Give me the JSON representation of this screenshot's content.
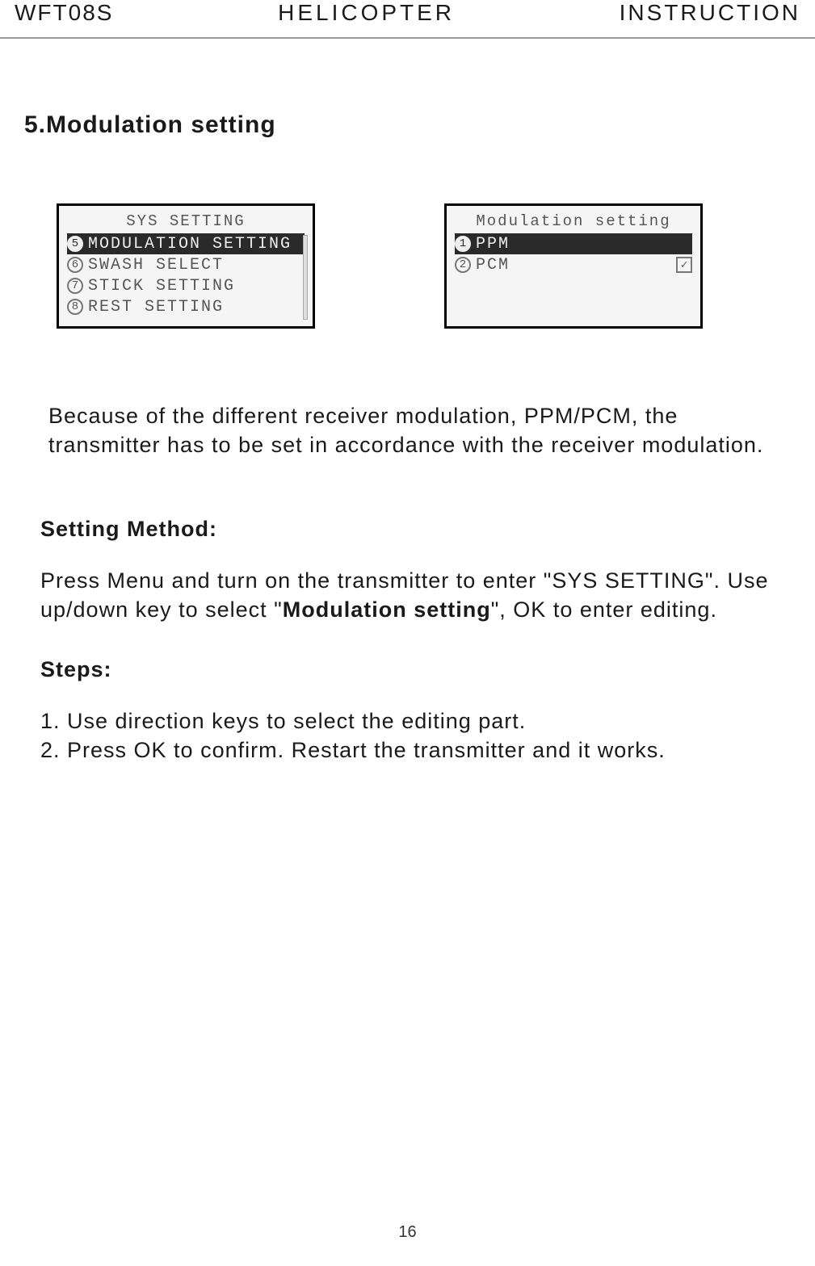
{
  "header": {
    "left": "WFT08S",
    "center": "HELICOPTER",
    "right": "INSTRUCTION"
  },
  "section_title": "5.Modulation setting",
  "lcd1": {
    "title": "SYS SETTING",
    "rows": [
      {
        "num": "5",
        "label": "MODULATION SETTING",
        "selected": true
      },
      {
        "num": "6",
        "label": "SWASH SELECT",
        "selected": false
      },
      {
        "num": "7",
        "label": "STICK SETTING",
        "selected": false
      },
      {
        "num": "8",
        "label": "REST SETTING",
        "selected": false
      }
    ]
  },
  "lcd2": {
    "title": "Modulation setting",
    "rows": [
      {
        "num": "1",
        "label": "PPM",
        "selected": true,
        "checked": false
      },
      {
        "num": "2",
        "label": "PCM",
        "selected": false,
        "checked": true
      }
    ]
  },
  "intro_para": "Because of the different receiver modulation, PPM/PCM, the transmitter has to be set in accordance with the receiver modulation.",
  "setting_method_label": "Setting Method:",
  "method_pre": "Press Menu and turn on the transmitter to enter \"SYS SETTING\". Use up/down key to select \"",
  "method_bold": "Modulation setting",
  "method_post": "\", OK to enter editing.",
  "steps_label": "Steps:",
  "steps": [
    "1. Use direction keys to select the editing part.",
    "2. Press OK to confirm. Restart the transmitter and it works."
  ],
  "page_number": "16",
  "check_glyph": "✓"
}
